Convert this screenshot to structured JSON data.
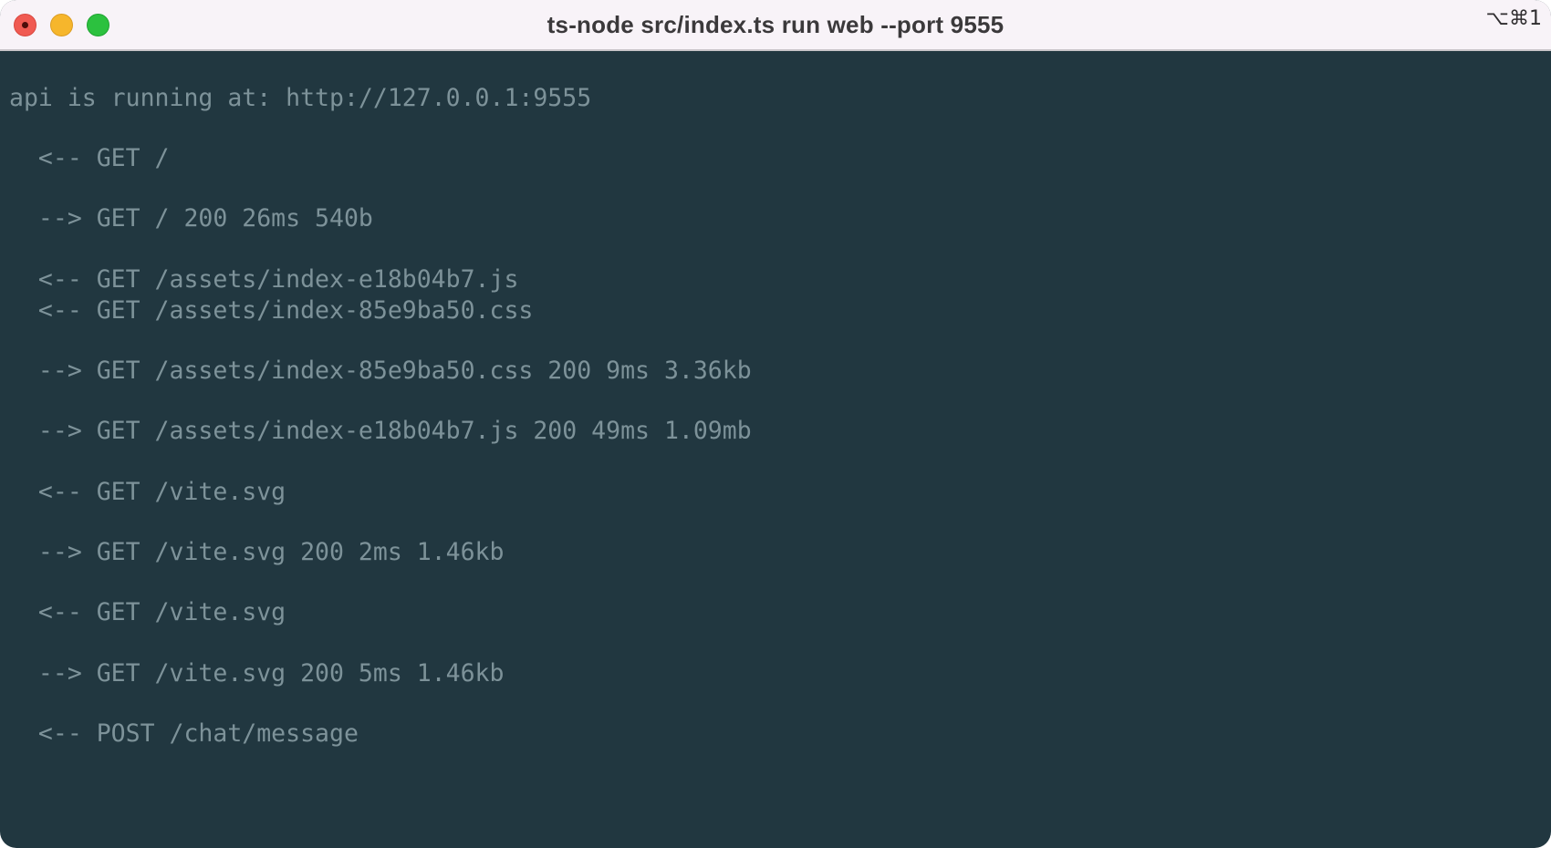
{
  "window": {
    "title": "ts-node src/index.ts run web --port 9555",
    "shortcut": "⌥⌘1"
  },
  "terminal": {
    "lines": [
      "api is running at: http://127.0.0.1:9555",
      "  <-- GET /",
      "  --> GET / 200 26ms 540b",
      "  <-- GET /assets/index-e18b04b7.js",
      "  <-- GET /assets/index-85e9ba50.css",
      "  --> GET /assets/index-85e9ba50.css 200 9ms 3.36kb",
      "  --> GET /assets/index-e18b04b7.js 200 49ms 1.09mb",
      "  <-- GET /vite.svg",
      "  --> GET /vite.svg 200 2ms 1.46kb",
      "  <-- GET /vite.svg",
      "  --> GET /vite.svg 200 5ms 1.46kb",
      "  <-- POST /chat/message"
    ]
  },
  "colors": {
    "background": "#213740",
    "text": "#7d9299",
    "titlebar": "#f8f3f8"
  }
}
